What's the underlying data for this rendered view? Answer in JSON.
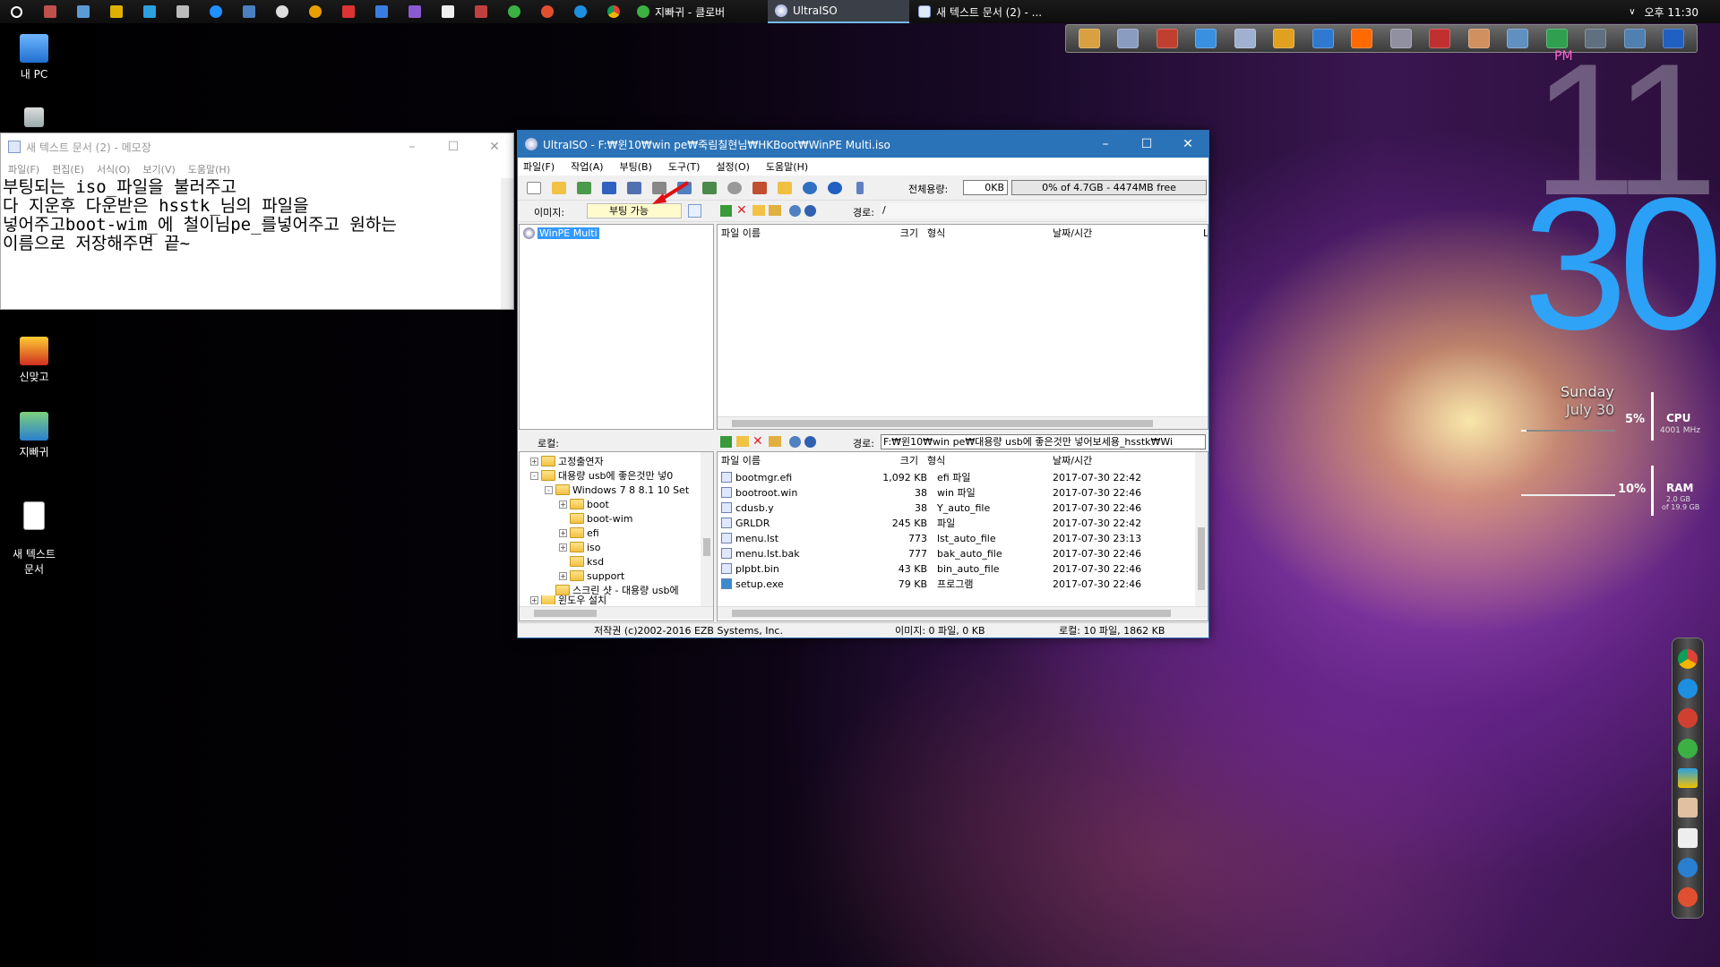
{
  "taskbar": {
    "tasks": [
      {
        "label": "지빠귀 - 클로버",
        "active": false
      },
      {
        "label": "UltraISO",
        "active": true
      },
      {
        "label": "새 텍스트 문서 (2) - ...",
        "active": false
      }
    ],
    "tray": {
      "time": "오후 11:30"
    }
  },
  "desktop": {
    "icons": [
      {
        "label": "내 PC"
      },
      {
        "label": "신맞고"
      },
      {
        "label": "지빠귀"
      },
      {
        "label": "새 텍스트\n문서"
      }
    ]
  },
  "notepad": {
    "title": "새 텍스트 문서 (2) - 메모장",
    "menu": [
      "파일(F)",
      "편집(E)",
      "서식(O)",
      "보기(V)",
      "도움말(H)"
    ],
    "content": "부팅되는 iso_파일을 불러주고\n다 지운후 다운받은 hsstk_님의 파일을\n넣어주고boot-wim_에 철이님pe_를넣어주고 원하는\n이름으로 저장해주면 끝~"
  },
  "ultraiso": {
    "title": "UltraISO - F:₩윈10₩win pe₩죽림칠현님₩HKBoot₩WinPE Multi.iso",
    "menu": [
      "파일(F)",
      "작업(A)",
      "부팅(B)",
      "도구(T)",
      "설정(O)",
      "도움말(H)"
    ],
    "total_label": "전체용량:",
    "total_value": "0KB",
    "capacity_bar": "0% of 4.7GB - 4474MB free",
    "image_label": "이미지:",
    "image_value": "부팅 가능",
    "path_label": "경로:",
    "iso_path": "/",
    "iso_tree_root": "WinPE Multi",
    "iso_columns": [
      "파일 이름",
      "크기",
      "형식",
      "날짜/시간",
      "L"
    ],
    "local_label": "로컬:",
    "local_path": "F:₩윈10₩win pe₩대용량 usb에 좋은것만 넣어보세용_hsstk₩Wi",
    "local_tree": [
      {
        "label": "고정출연자",
        "level": 0,
        "expand": "+"
      },
      {
        "label": "대용량 usb에 좋은것만 넣0",
        "level": 0,
        "expand": "-"
      },
      {
        "label": "Windows 7 8 8.1 10 Set",
        "level": 1,
        "expand": "-"
      },
      {
        "label": "boot",
        "level": 2,
        "expand": "+"
      },
      {
        "label": "boot-wim",
        "level": 2,
        "expand": ""
      },
      {
        "label": "efi",
        "level": 2,
        "expand": "+"
      },
      {
        "label": "iso",
        "level": 2,
        "expand": "+"
      },
      {
        "label": "ksd",
        "level": 2,
        "expand": ""
      },
      {
        "label": "support",
        "level": 2,
        "expand": "+"
      },
      {
        "label": "스크린 샷 - 대용량 usb에",
        "level": 1,
        "expand": ""
      },
      {
        "label": "윈도우 설치",
        "level": 0,
        "expand": "+"
      }
    ],
    "local_columns": [
      "파일 이름",
      "크기",
      "형식",
      "날짜/시간"
    ],
    "local_files": [
      {
        "name": "bootmgr.efi",
        "size": "1,092 KB",
        "type": "efi 파일",
        "date": "2017-07-30 22:42"
      },
      {
        "name": "bootroot.win",
        "size": "38",
        "type": "win 파일",
        "date": "2017-07-30 22:46"
      },
      {
        "name": "cdusb.y",
        "size": "38",
        "type": "Y_auto_file",
        "date": "2017-07-30 22:46"
      },
      {
        "name": "GRLDR",
        "size": "245 KB",
        "type": "파일",
        "date": "2017-07-30 22:42"
      },
      {
        "name": "menu.lst",
        "size": "773",
        "type": "lst_auto_file",
        "date": "2017-07-30 23:13"
      },
      {
        "name": "menu.lst.bak",
        "size": "777",
        "type": "bak_auto_file",
        "date": "2017-07-30 22:46"
      },
      {
        "name": "plpbt.bin",
        "size": "43 KB",
        "type": "bin_auto_file",
        "date": "2017-07-30 22:46"
      },
      {
        "name": "setup.exe",
        "size": "79 KB",
        "type": "프로그램",
        "date": "2017-07-30 22:46"
      }
    ],
    "status": {
      "copyright": "저작권 (c)2002-2016 EZB Systems, Inc.",
      "image": "이미지: 0 파일, 0 KB",
      "local": "로컬: 10 파일, 1862 KB"
    }
  },
  "gadget": {
    "ampm": "PM",
    "hour": "11",
    "minute": "30",
    "day": "Sunday",
    "date": "July 30",
    "cpu_percent": "5%",
    "cpu_label": "CPU",
    "cpu_speed": "4001 MHz",
    "ram_percent": "10%",
    "ram_label": "RAM",
    "ram_used": "2.0 GB",
    "ram_total": "of 19.9 GB"
  }
}
